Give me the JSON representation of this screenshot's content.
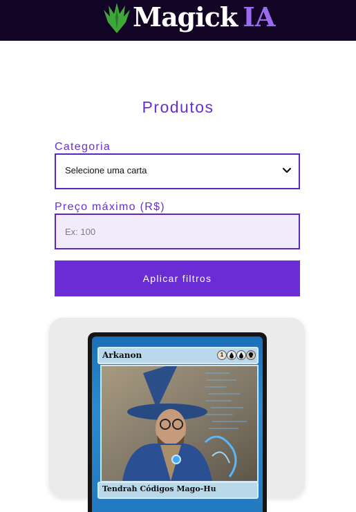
{
  "header": {
    "brand_word": "Magick",
    "brand_suffix": "IA",
    "logo_icon": "planeswalker-leaf-icon",
    "background_color": "#120424",
    "suffix_color": "#9a6bf0",
    "icon_color": "#3fa63a"
  },
  "page": {
    "title": "Produtos",
    "accent_color": "#6a2cd4"
  },
  "filters": {
    "category_label": "Categoria",
    "category_value": "Selecione uma carta",
    "price_label": "Preço máximo (R$)",
    "price_placeholder": "Ex: 100",
    "apply_label": "Aplicar filtros"
  },
  "products": [
    {
      "card_name": "Arkanon",
      "card_type": "Tendrah Códigos Mago-Hu",
      "mana_cost": [
        "1",
        "water",
        "water",
        "skull"
      ]
    }
  ]
}
